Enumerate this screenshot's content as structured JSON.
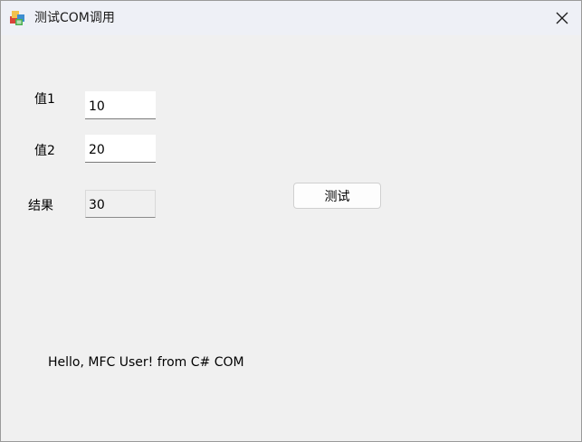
{
  "window": {
    "title": "测试COM调用",
    "icon": "mfc-app-icon"
  },
  "form": {
    "value1_label": "值1",
    "value1": "10",
    "value2_label": "值2",
    "value2": "20",
    "result_label": "结果",
    "result": "30",
    "test_button_label": "测试",
    "message": "Hello, MFC User! from C# COM"
  }
}
